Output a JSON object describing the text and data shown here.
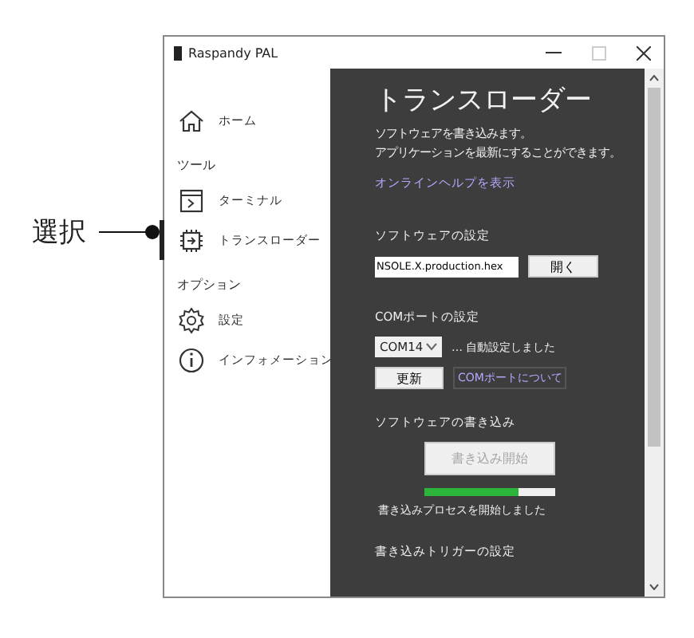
{
  "callout": {
    "label": "選択"
  },
  "window": {
    "title": "Raspandy PAL"
  },
  "sidebar": {
    "groups": [
      {
        "items": [
          {
            "label": "ホーム",
            "selected": false
          }
        ]
      },
      {
        "header": "ツール",
        "items": [
          {
            "label": "ターミナル",
            "selected": false
          },
          {
            "label": "トランスローダー",
            "selected": true
          }
        ]
      },
      {
        "header": "オプション",
        "items": [
          {
            "label": "設定",
            "selected": false
          },
          {
            "label": "インフォメーション",
            "selected": false
          }
        ]
      }
    ]
  },
  "content": {
    "title": "トランスローダー",
    "description": [
      "ソフトウェアを書き込みます。",
      "アプリケーションを最新にすることができます。"
    ],
    "help_link": "オンラインヘルプを表示",
    "software_settings": {
      "heading": "ソフトウェアの設定",
      "file_field": "NSOLE.X.production.hex",
      "open_button": "開く"
    },
    "com_settings": {
      "heading": "COMポートの設定",
      "port": "COM14",
      "status": "… 自動設定しました",
      "refresh_button": "更新",
      "about_link": "COMポートについて"
    },
    "write": {
      "heading": "ソフトウェアの書き込み",
      "start_button": "書き込み開始",
      "start_disabled": true,
      "level": 0.72,
      "message": "書き込みプロセスを開始しました"
    },
    "trigger": {
      "heading": "書き込みトリガーの設定"
    }
  }
}
